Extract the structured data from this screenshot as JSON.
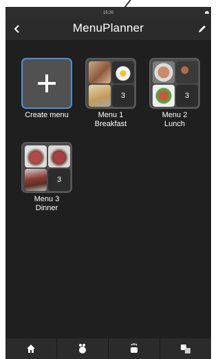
{
  "status": {
    "time": "15:20"
  },
  "header": {
    "title": "MenuPlanner",
    "back_icon": "back-chevron-icon",
    "edit_icon": "pencil-icon"
  },
  "create": {
    "label": "Create menu"
  },
  "menus": [
    {
      "name": "Menu 1",
      "meal": "Breakfast",
      "count": "3"
    },
    {
      "name": "Menu 2",
      "meal": "Lunch",
      "count": "3"
    },
    {
      "name": "Menu 3",
      "meal": "Dinner",
      "count": "3"
    }
  ],
  "bottom_nav": [
    "home-icon",
    "chef-icon",
    "pot-icon",
    "translate-icon"
  ],
  "colors": {
    "background": "#1f1f1f",
    "bar": "#2b2b2b",
    "accent": "#4f8fd6"
  }
}
